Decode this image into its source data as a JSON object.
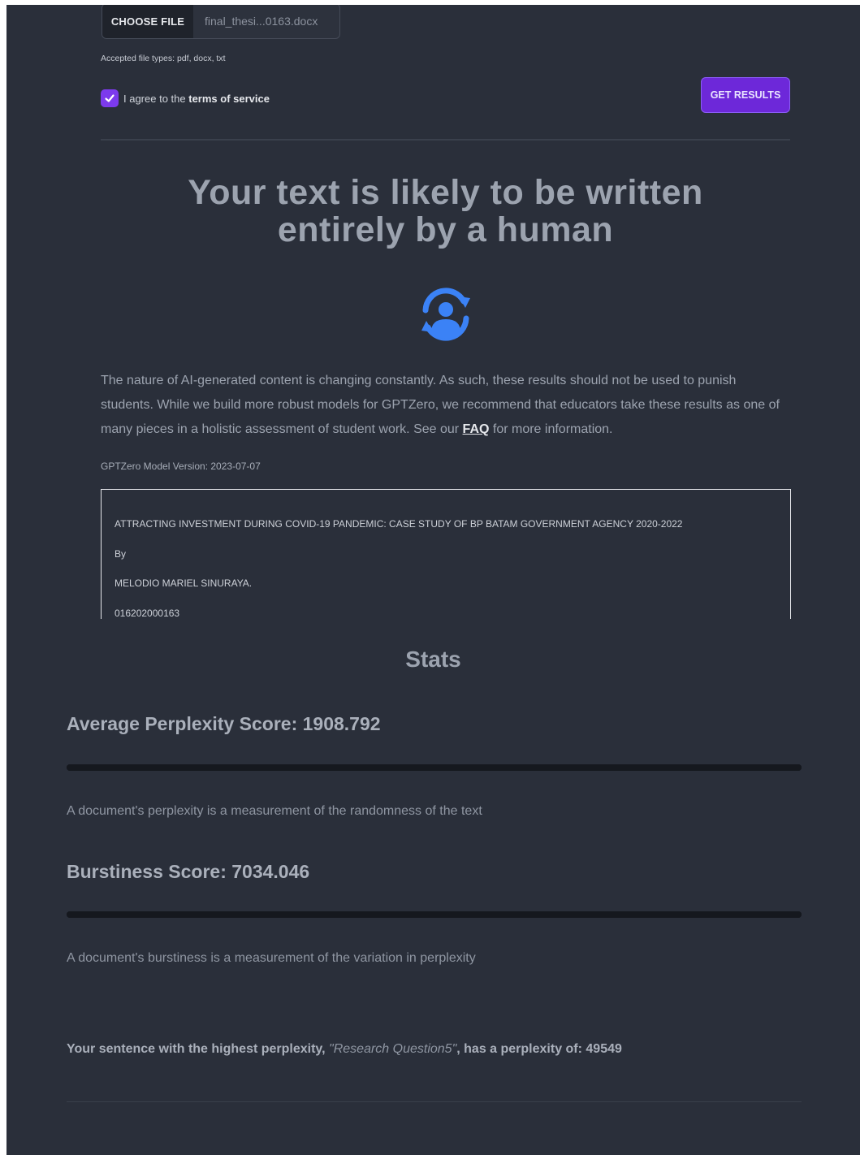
{
  "upload": {
    "choose_label": "Choose File",
    "file_name": "final_thesi...0163.docx",
    "accepted": "Accepted file types: pdf, docx, txt"
  },
  "agreement": {
    "prefix": "I agree to the ",
    "terms": "terms of service",
    "checked": true
  },
  "get_results": "GET RESULTS",
  "result": {
    "headline_1": "Your text is likely to be written",
    "headline_2": "entirely by a human",
    "icon": "human-person-icon",
    "icon_color": "#3b82f6"
  },
  "notice": {
    "text": "The nature of AI-generated content is changing constantly. As such, these results should not be used to punish students. While we build more robust models for GPTZero, we recommend that educators take these results as one of many pieces in a holistic assessment of student work. See our ",
    "faq": "FAQ",
    "suffix": " for more information."
  },
  "model_version": "GPTZero Model Version: 2023-07-07",
  "document_lines": [
    "ATTRACTING INVESTMENT DURING COVID-19 PANDEMIC: CASE STUDY OF BP BATAM GOVERNMENT AGENCY 2020-2022",
    "By",
    "MELODIO MARIEL SINURAYA.",
    "016202000163"
  ],
  "stats": {
    "title": "Stats",
    "perplexity_label": "Average Perplexity Score: 1908.792",
    "perplexity_desc": "A document's perplexity is a measurement of the randomness of the text",
    "burstiness_label": "Burstiness Score: 7034.046",
    "burstiness_desc": "A document's burstiness is a measurement of the variation in perplexity"
  },
  "highest": {
    "prefix": "Your sentence with the highest perplexity, ",
    "sentence": "\"Research Question5\"",
    "suffix": ", has a perplexity of: 49549"
  },
  "colors": {
    "background": "#2a2f3a",
    "accent": "#6d28d9",
    "human_icon": "#3b82f6"
  }
}
